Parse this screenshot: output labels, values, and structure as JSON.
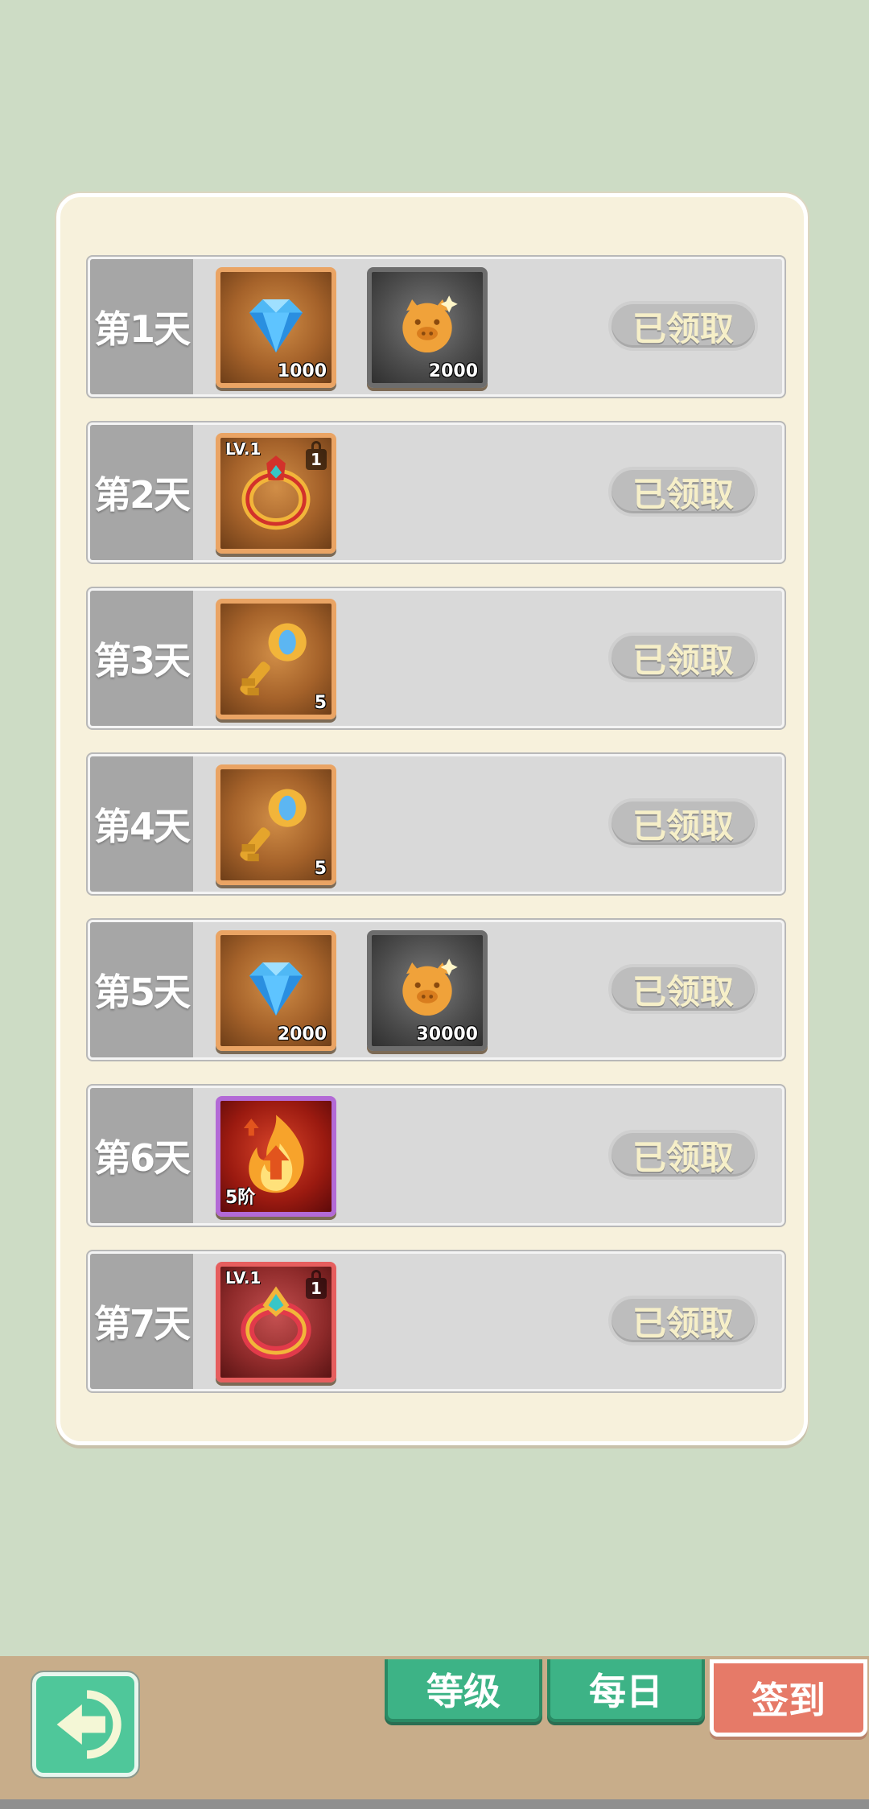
{
  "rows": [
    {
      "day": "第1天",
      "claim_label": "已领取",
      "items": [
        {
          "kind": "diamond",
          "frame": "orange",
          "qty": "1000"
        },
        {
          "kind": "coin",
          "frame": "gray",
          "qty": "2000"
        }
      ]
    },
    {
      "day": "第2天",
      "claim_label": "已领取",
      "items": [
        {
          "kind": "ring-gold",
          "frame": "orange",
          "level": "LV.1",
          "level_num": "1"
        }
      ]
    },
    {
      "day": "第3天",
      "claim_label": "已领取",
      "items": [
        {
          "kind": "key",
          "frame": "orange",
          "qty": "5"
        }
      ]
    },
    {
      "day": "第4天",
      "claim_label": "已领取",
      "items": [
        {
          "kind": "key",
          "frame": "orange",
          "qty": "5"
        }
      ]
    },
    {
      "day": "第5天",
      "claim_label": "已领取",
      "items": [
        {
          "kind": "diamond",
          "frame": "orange",
          "qty": "2000"
        },
        {
          "kind": "coin",
          "frame": "gray",
          "qty": "30000"
        }
      ]
    },
    {
      "day": "第6天",
      "claim_label": "已领取",
      "items": [
        {
          "kind": "fire-upgrade",
          "frame": "purple",
          "tier": "5阶"
        }
      ]
    },
    {
      "day": "第7天",
      "claim_label": "已领取",
      "items": [
        {
          "kind": "ring-red",
          "frame": "red",
          "level": "LV.1",
          "level_num": "1"
        }
      ]
    }
  ],
  "tabs": {
    "level": "等级",
    "daily": "每日",
    "signin": "签到"
  },
  "back_icon": "arrow-left-icon",
  "colors": {
    "background": "#cddcc5",
    "panel": "#f7f1dc",
    "tab_green": "#3db386",
    "tab_active": "#e67a68"
  }
}
